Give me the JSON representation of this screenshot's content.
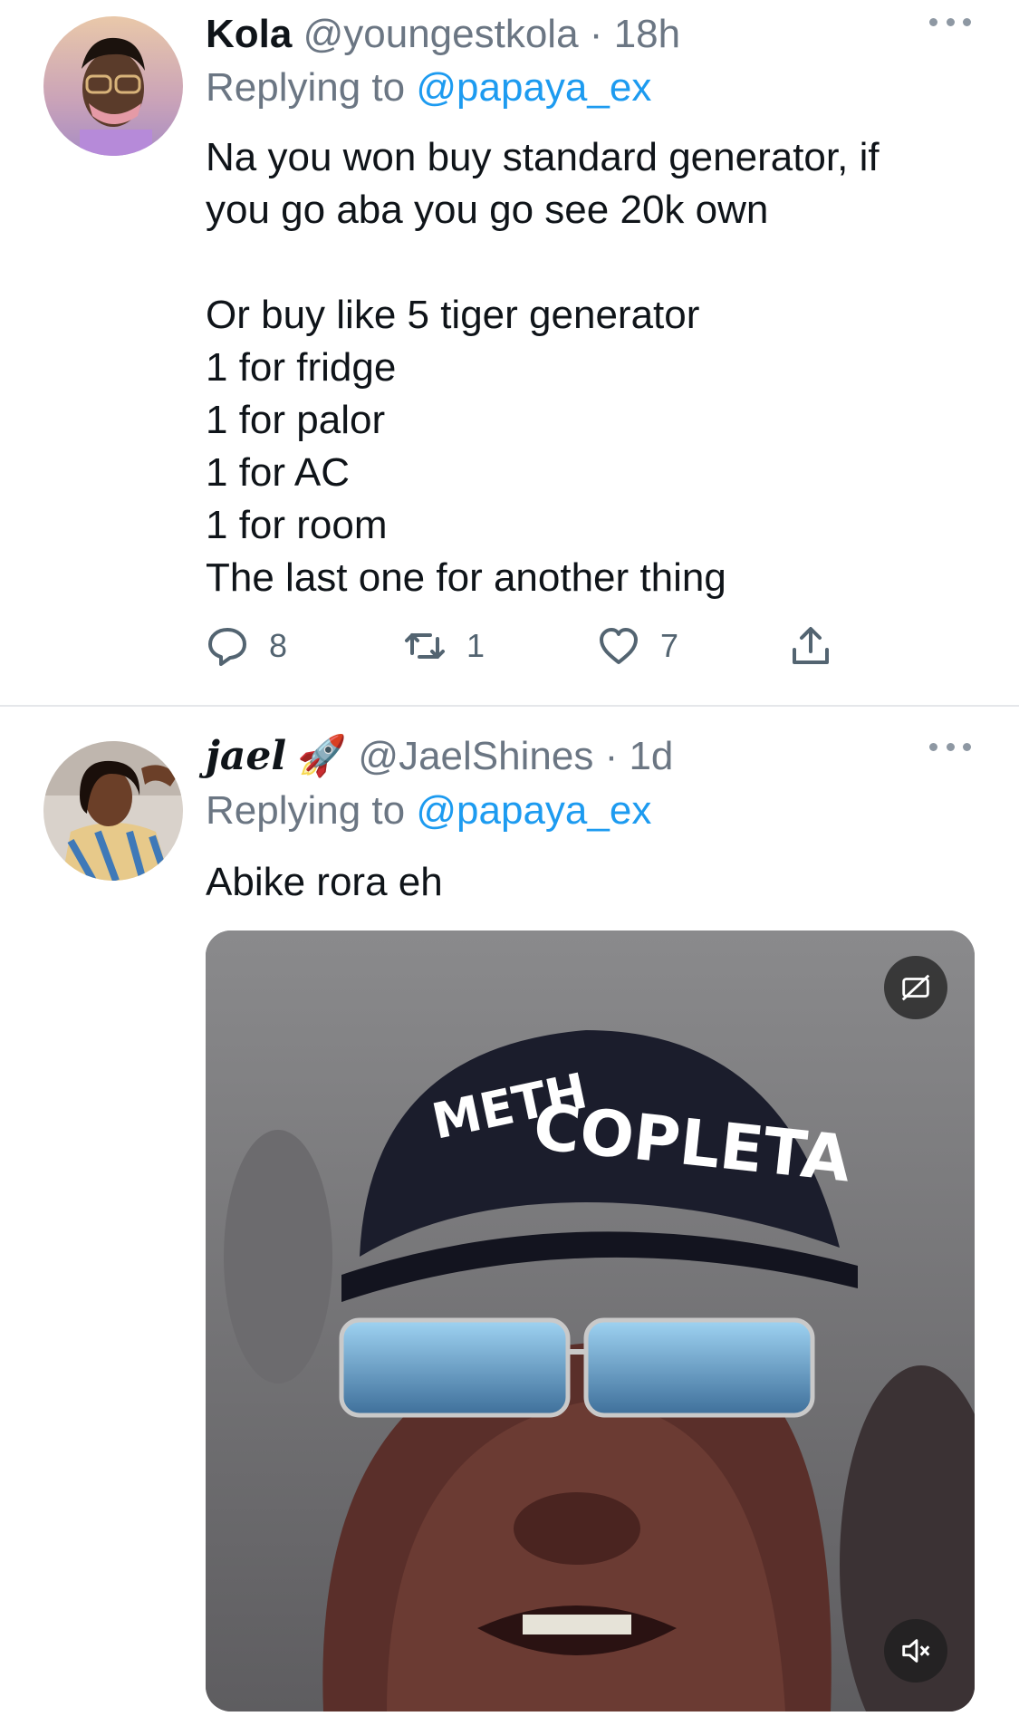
{
  "tweets": [
    {
      "name": "Kola",
      "handle": "@youngestkola",
      "separator": "·",
      "time": "18h",
      "replying_prefix": "Replying to",
      "replying_to": "@papaya_ex",
      "lines": [
        "Na you won buy standard generator, if",
        "you go aba you go see 20k own",
        "",
        "Or buy like 5 tiger generator",
        "1 for fridge",
        "1 for palor",
        "1 for AC",
        "1 for room",
        "The last one for another thing"
      ],
      "actions": {
        "replies": "8",
        "retweets": "1",
        "likes": "7"
      }
    },
    {
      "name": "jael",
      "name_emoji": "🚀",
      "handle": "@JaelShines",
      "separator": "·",
      "time": "1d",
      "replying_prefix": "Replying to",
      "replying_to": "@papaya_ex",
      "text": "Abike rora eh",
      "media": {
        "cap_text": "COPLETA",
        "cap_text_left": "METH"
      }
    }
  ],
  "icons": {
    "reply": "speech-bubble-icon",
    "retweet": "retweet-icon",
    "like": "heart-icon",
    "share": "share-icon",
    "more": "more-dots-icon",
    "captions": "captions-off-icon",
    "mute": "volume-muted-icon"
  },
  "colors": {
    "link": "#1d9bf0",
    "secondary": "#6b7683",
    "text": "#0f1419",
    "divider": "#e5e7ea"
  }
}
